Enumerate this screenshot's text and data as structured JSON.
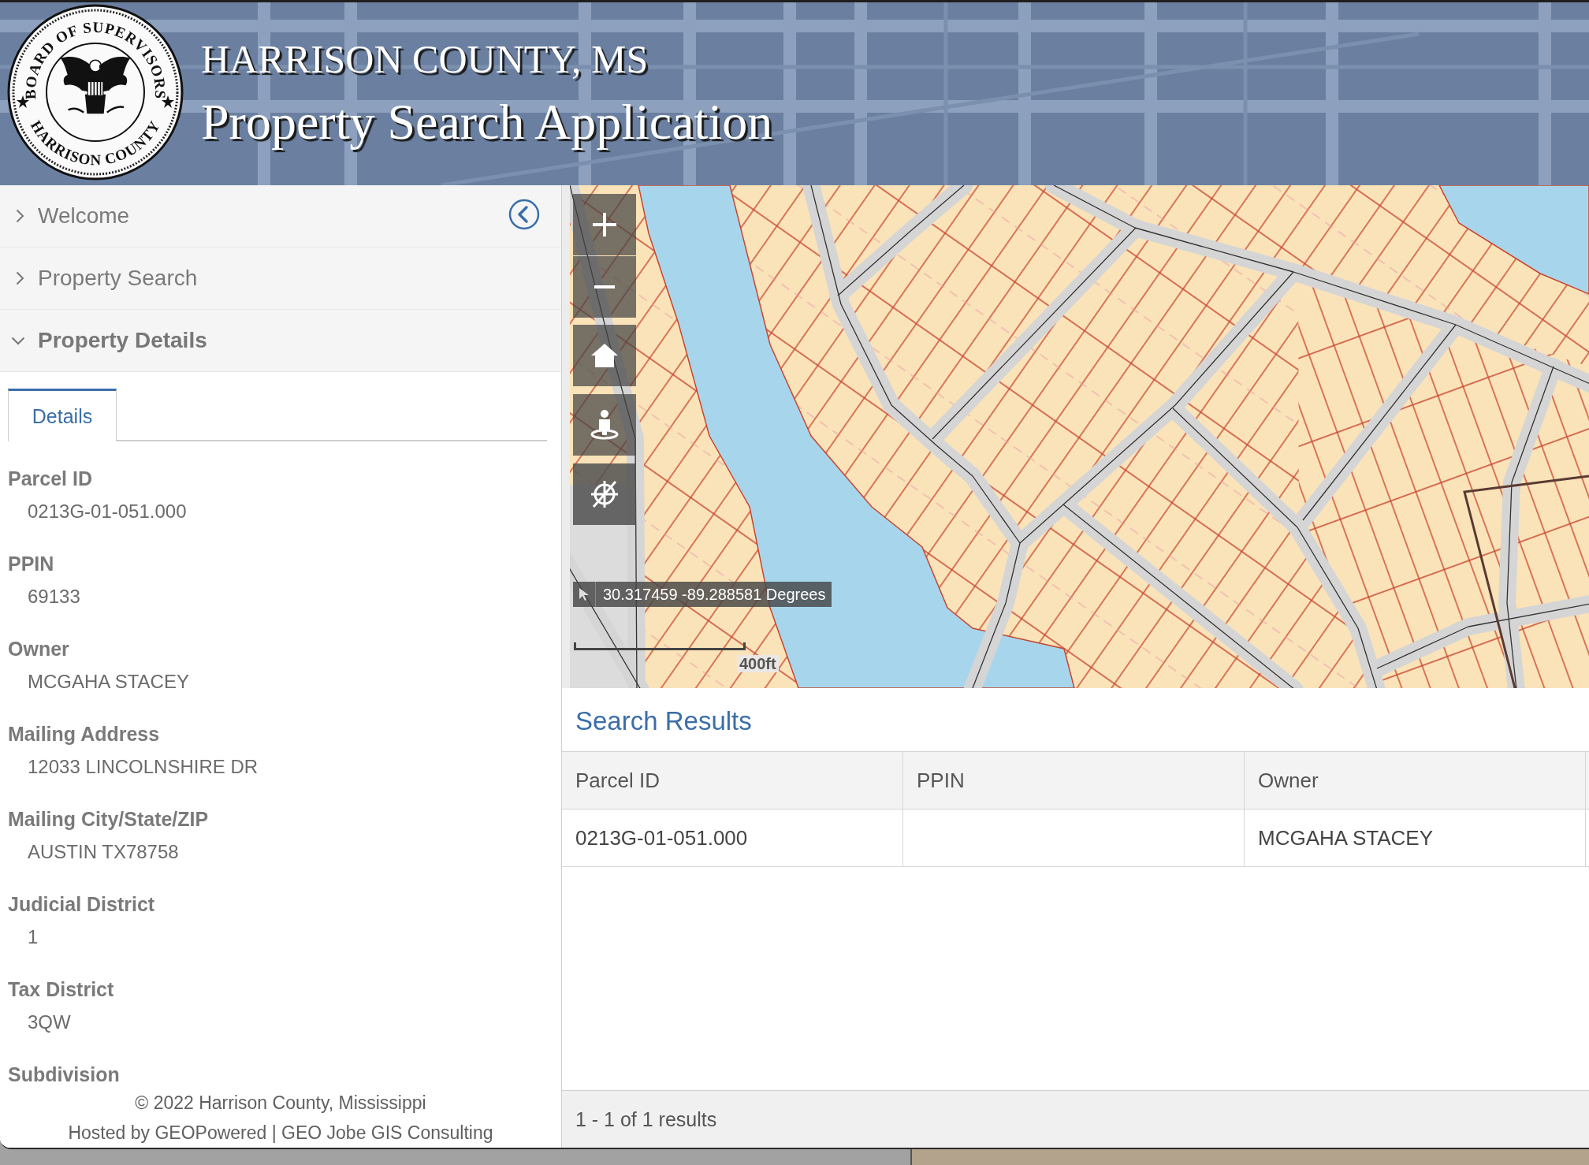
{
  "header": {
    "seal": {
      "top_text": "BOARD OF SUPERVISORS",
      "bottom_text": "HARRISON COUNTY"
    },
    "title": "HARRISON COUNTY, MS",
    "subtitle": "Property Search Application"
  },
  "sidebar": {
    "sections": [
      {
        "label": "Welcome",
        "expanded": false
      },
      {
        "label": "Property Search",
        "expanded": false
      },
      {
        "label": "Property Details",
        "expanded": true
      }
    ],
    "tabs": [
      {
        "label": "Details",
        "selected": true
      }
    ],
    "fields": [
      {
        "label": "Parcel ID",
        "value": "0213G-01-051.000"
      },
      {
        "label": "PPIN",
        "value": "69133"
      },
      {
        "label": "Owner",
        "value": "MCGAHA STACEY"
      },
      {
        "label": "Mailing Address",
        "value": "12033 LINCOLNSHIRE DR"
      },
      {
        "label": "Mailing City/State/ZIP",
        "value": "AUSTIN TX78758"
      },
      {
        "label": "Judicial District",
        "value": "1"
      },
      {
        "label": "Tax District",
        "value": "3QW"
      },
      {
        "label": "Subdivision"
      }
    ],
    "footer": {
      "copyright": "© 2022 Harrison County, Mississippi",
      "hosted_by": "Hosted by GEOPowered | GEO Jobe GIS Consulting"
    }
  },
  "map": {
    "coordinates": "30.317459 -89.288581 Degrees",
    "scale_label": "400ft"
  },
  "search_results": {
    "title": "Search Results",
    "columns": [
      "Parcel ID",
      "PPIN",
      "Owner"
    ],
    "rows": [
      {
        "cells": [
          "0213G-01-051.000",
          null,
          "MCGAHA STACEY"
        ]
      }
    ],
    "summary": "1 - 1 of 1 results"
  }
}
